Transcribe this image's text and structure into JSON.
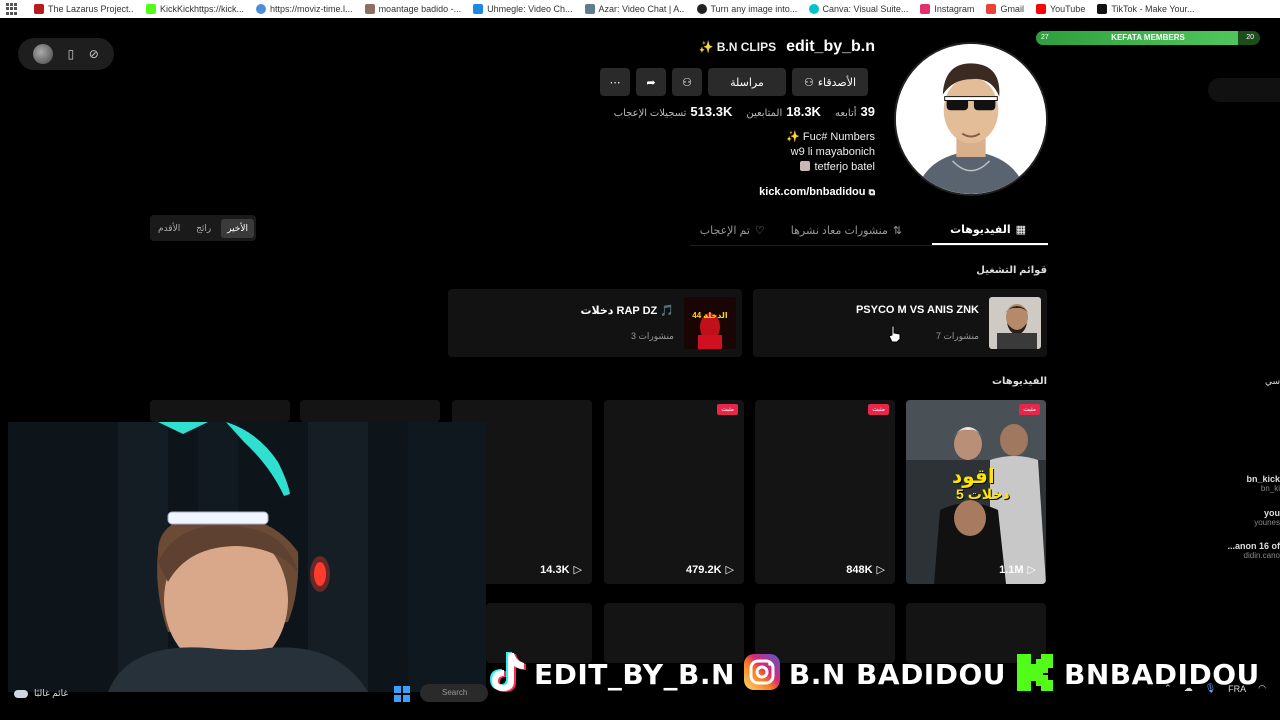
{
  "bookmarks": [
    {
      "label": "The Lazarus Project...",
      "color": "#b71c1c"
    },
    {
      "label": "KickKickhttps://kick...",
      "color": "#53fc18"
    },
    {
      "label": "https://moviz-time.l...",
      "color": "#4a90d9"
    },
    {
      "label": "moantage badido -...",
      "color": "#8d6e63"
    },
    {
      "label": "Uhmegle: Video Ch...",
      "color": "#1e88e5"
    },
    {
      "label": "Azar: Video Chat | A...",
      "color": "#607d8b"
    },
    {
      "label": "Turn any image into...",
      "color": "#212121"
    },
    {
      "label": "Canva: Visual Suite...",
      "color": "#00c4cc"
    },
    {
      "label": "Instagram",
      "color": "#e1306c"
    },
    {
      "label": "Gmail",
      "color": "#ea4335"
    },
    {
      "label": "YouTube",
      "color": "#ff0000"
    },
    {
      "label": "TikTok - Make Your...",
      "color": "#111111"
    }
  ],
  "profile": {
    "handle": "edit_by_b.n",
    "nickname": "✨ B.N CLIPS",
    "buttons": {
      "friends": "الأصدقاء",
      "message": "مراسلة"
    },
    "stats": [
      {
        "value": "39",
        "label": "أتابعه"
      },
      {
        "value": "18.3K",
        "label": "المتابعين"
      },
      {
        "value": "513.3K",
        "label": "تسجيلات الإعجاب"
      }
    ],
    "bio": [
      "✨ Fuc# Numbers",
      "w9 li mayabonich",
      "tetferjo batel"
    ],
    "link": "kick.com/bnbadidou"
  },
  "sort": {
    "options": [
      "الأخير",
      "رائج",
      "الأقدم"
    ],
    "active": 0
  },
  "tabs": [
    {
      "label": "الفيديوهات",
      "icon": "grid-icon",
      "active": true
    },
    {
      "label": "منشورات معاد نشرها",
      "icon": "repost-icon",
      "active": false
    },
    {
      "label": "تم الإعجاب",
      "icon": "heart-lock-icon",
      "active": false
    }
  ],
  "sections": {
    "playlists": "قوائم التشغيل",
    "videos": "الفيديوهات"
  },
  "playlists": [
    {
      "title": "PSYCO M VS ANIS ZNK",
      "count": "7 منشورات"
    },
    {
      "title": "دخلات RAP DZ 🎵",
      "count": "3 منشورات",
      "thumb_text": "الدخلة 44"
    }
  ],
  "videos": [
    {
      "views": "1.1M",
      "pinned": true,
      "pin_label": "مثبت",
      "overlay": "اقود",
      "overlay2": "5 دخلات"
    },
    {
      "views": "848K",
      "pinned": true,
      "pin_label": "مثبت"
    },
    {
      "views": "479.2K",
      "pinned": true,
      "pin_label": "مثبت"
    },
    {
      "views": "14.3K",
      "pinned": false
    }
  ],
  "overlay": {
    "tiktok": "EDIT_BY_B.N",
    "instagram": "B.N BADIDOU",
    "kick": "BNBADIDOU"
  },
  "taskbar": {
    "weather": "غائم غالبًا",
    "lang": "FRA",
    "search": "Search"
  },
  "right_panel": {
    "members_label": "KEFATA MEMBERS",
    "members_low": "27",
    "members_high": "20",
    "members_progress": 0.9,
    "chat": [
      {
        "name": "bn_kick",
        "sub": "bn_ki"
      },
      {
        "name": "you",
        "sub": "younes"
      },
      {
        "name": "...anon 16 of",
        "sub": "didin.cano"
      }
    ],
    "side_label": "سي"
  },
  "colors": {
    "accent": "#e6274a",
    "kick_green": "#53fc18",
    "bg": "#000000"
  }
}
